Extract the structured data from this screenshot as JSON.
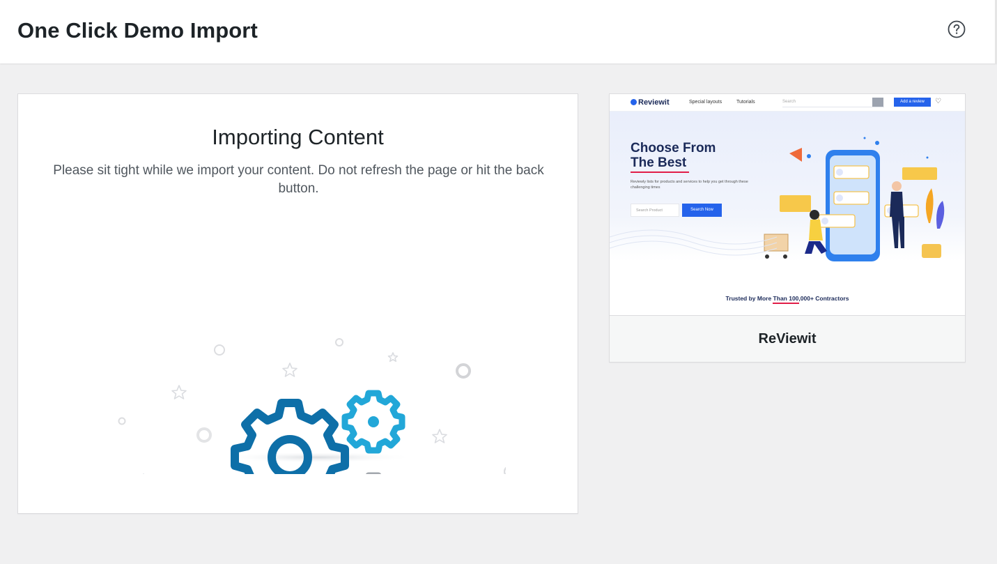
{
  "header": {
    "title": "One Click Demo Import",
    "help_icon": "question-circle-icon"
  },
  "import": {
    "title": "Importing Content",
    "description": "Please sit tight while we import your content. Do not refresh the page or hit the back button.",
    "illustration_icon": "gears-icon"
  },
  "demo": {
    "name": "ReViewit",
    "preview": {
      "logo": "Reviewit",
      "nav_items": [
        "Special layouts",
        "Tutorials"
      ],
      "search_placeholder": "Search",
      "add_button": "Add a review",
      "headline_line1": "Choose From",
      "headline_line2": "The Best",
      "subtext": "Reviewly lists for products and services to help you get through these challenging times",
      "search_product_placeholder": "Search Product",
      "search_now": "Search Now",
      "trusted": "Trusted by More Than 100,000+ Contractors"
    }
  },
  "colors": {
    "background": "#f0f0f1",
    "gear_large": "#0e6fa8",
    "gear_small": "#22a7d8",
    "gear_grey": "#a2a7ad",
    "accent_blue": "#2563eb"
  }
}
